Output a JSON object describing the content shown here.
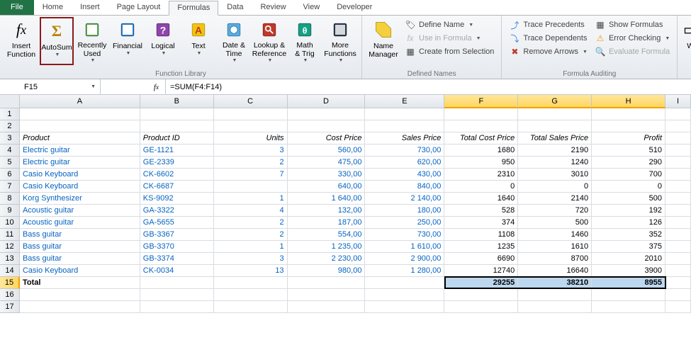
{
  "tabs": [
    "File",
    "Home",
    "Insert",
    "Page Layout",
    "Formulas",
    "Data",
    "Review",
    "View",
    "Developer"
  ],
  "active_tab": "Formulas",
  "ribbon": {
    "groups": {
      "fnlib": {
        "label": "Function Library",
        "insert_fn": "Insert\nFunction",
        "autosum": "AutoSum",
        "recent": "Recently\nUsed",
        "financial": "Financial",
        "logical": "Logical",
        "text": "Text",
        "datetime": "Date &\nTime",
        "lookup": "Lookup &\nReference",
        "math": "Math\n& Trig",
        "more": "More\nFunctions"
      },
      "names": {
        "label": "Defined Names",
        "name_mgr": "Name\nManager",
        "define": "Define Name",
        "use": "Use in Formula",
        "create": "Create from Selection"
      },
      "audit": {
        "label": "Formula Auditing",
        "prec": "Trace Precedents",
        "dep": "Trace Dependents",
        "remove": "Remove Arrows",
        "show": "Show Formulas",
        "error": "Error Checking",
        "eval": "Evaluate Formula"
      },
      "extra": {
        "w": "W"
      }
    }
  },
  "name_box": "F15",
  "formula": "=SUM(F4:F14)",
  "columns": [
    "A",
    "B",
    "C",
    "D",
    "E",
    "F",
    "G",
    "H",
    "I"
  ],
  "headers": {
    "A": "Product",
    "B": "Product ID",
    "C": "Units",
    "D": "Cost Price",
    "E": "Sales Price",
    "F": "Total Cost Price",
    "G": "Total Sales Price",
    "H": "Profit"
  },
  "rows": [
    {
      "A": "Electric guitar",
      "B": "GE-1121",
      "C": "3",
      "D": "560,00",
      "E": "730,00",
      "F": "1680",
      "G": "2190",
      "H": "510"
    },
    {
      "A": "Electric guitar",
      "B": "GE-2339",
      "C": "2",
      "D": "475,00",
      "E": "620,00",
      "F": "950",
      "G": "1240",
      "H": "290"
    },
    {
      "A": "Casio Keyboard",
      "B": "CK-6602",
      "C": "7",
      "D": "330,00",
      "E": "430,00",
      "F": "2310",
      "G": "3010",
      "H": "700"
    },
    {
      "A": "Casio Keyboard",
      "B": "CK-6687",
      "C": "",
      "D": "640,00",
      "E": "840,00",
      "F": "0",
      "G": "0",
      "H": "0"
    },
    {
      "A": "Korg Synthesizer",
      "B": "KS-9092",
      "C": "1",
      "D": "1 640,00",
      "E": "2 140,00",
      "F": "1640",
      "G": "2140",
      "H": "500"
    },
    {
      "A": "Acoustic guitar",
      "B": "GA-3322",
      "C": "4",
      "D": "132,00",
      "E": "180,00",
      "F": "528",
      "G": "720",
      "H": "192"
    },
    {
      "A": "Acoustic guitar",
      "B": "GA-5655",
      "C": "2",
      "D": "187,00",
      "E": "250,00",
      "F": "374",
      "G": "500",
      "H": "126"
    },
    {
      "A": "Bass guitar",
      "B": "GB-3367",
      "C": "2",
      "D": "554,00",
      "E": "730,00",
      "F": "1108",
      "G": "1460",
      "H": "352"
    },
    {
      "A": "Bass guitar",
      "B": "GB-3370",
      "C": "1",
      "D": "1 235,00",
      "E": "1 610,00",
      "F": "1235",
      "G": "1610",
      "H": "375"
    },
    {
      "A": "Bass guitar",
      "B": "GB-3374",
      "C": "3",
      "D": "2 230,00",
      "E": "2 900,00",
      "F": "6690",
      "G": "8700",
      "H": "2010"
    },
    {
      "A": "Casio Keyboard",
      "B": "CK-0034",
      "C": "13",
      "D": "980,00",
      "E": "1 280,00",
      "F": "12740",
      "G": "16640",
      "H": "3900"
    }
  ],
  "totals": {
    "label": "Total",
    "F": "29255",
    "G": "38210",
    "H": "8955"
  }
}
